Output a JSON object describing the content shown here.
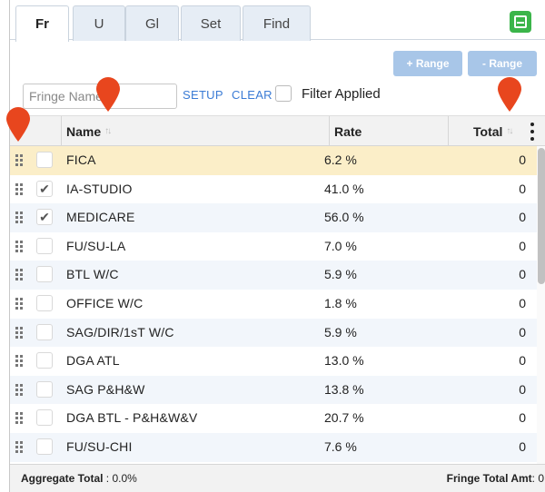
{
  "tabs": [
    {
      "label": "Fr",
      "active": true
    },
    {
      "label": "U",
      "active": false
    },
    {
      "label": "Gl",
      "active": false
    },
    {
      "label": "Set",
      "active": false
    },
    {
      "label": "Find",
      "active": false
    }
  ],
  "toolbar": {
    "add_range_label": "+ Range",
    "remove_range_label": "- Range"
  },
  "search": {
    "placeholder": "Fringe Name",
    "value": ""
  },
  "links": {
    "setup": "SETUP",
    "clear": "CLEAR"
  },
  "filter": {
    "label": "Filter Applied",
    "checked": false
  },
  "table": {
    "columns": {
      "name": "Name",
      "rate": "Rate",
      "total": "Total"
    },
    "rows": [
      {
        "name": "FICA",
        "rate": "6.2 %",
        "total": "0",
        "checked": false,
        "selected": true
      },
      {
        "name": "IA-STUDIO",
        "rate": "41.0 %",
        "total": "0",
        "checked": true,
        "selected": false
      },
      {
        "name": "MEDICARE",
        "rate": "56.0 %",
        "total": "0",
        "checked": true,
        "selected": false
      },
      {
        "name": "FU/SU-LA",
        "rate": "7.0 %",
        "total": "0",
        "checked": false,
        "selected": false
      },
      {
        "name": "BTL W/C",
        "rate": "5.9 %",
        "total": "0",
        "checked": false,
        "selected": false
      },
      {
        "name": "OFFICE W/C",
        "rate": "1.8 %",
        "total": "0",
        "checked": false,
        "selected": false
      },
      {
        "name": "SAG/DIR/1sT W/C",
        "rate": "5.9 %",
        "total": "0",
        "checked": false,
        "selected": false
      },
      {
        "name": "DGA ATL",
        "rate": "13.0 %",
        "total": "0",
        "checked": false,
        "selected": false
      },
      {
        "name": "SAG P&H&W",
        "rate": "13.8 %",
        "total": "0",
        "checked": false,
        "selected": false
      },
      {
        "name": "DGA BTL - P&H&W&V",
        "rate": "20.7 %",
        "total": "0",
        "checked": false,
        "selected": false
      },
      {
        "name": "FU/SU-CHI",
        "rate": "7.6 %",
        "total": "0",
        "checked": false,
        "selected": false
      }
    ]
  },
  "footer": {
    "aggregate_label": "Aggregate Total",
    "aggregate_value": " : 0.0%",
    "fringe_total_label": "Fringe Total Amt",
    "fringe_total_value": ": 0"
  },
  "colors": {
    "accent": "#3a7bd5",
    "pin": "#e8461e",
    "selected_row": "#fbeec8",
    "collapse_button": "#3bb54a",
    "range_button": "#a8c6e8"
  }
}
